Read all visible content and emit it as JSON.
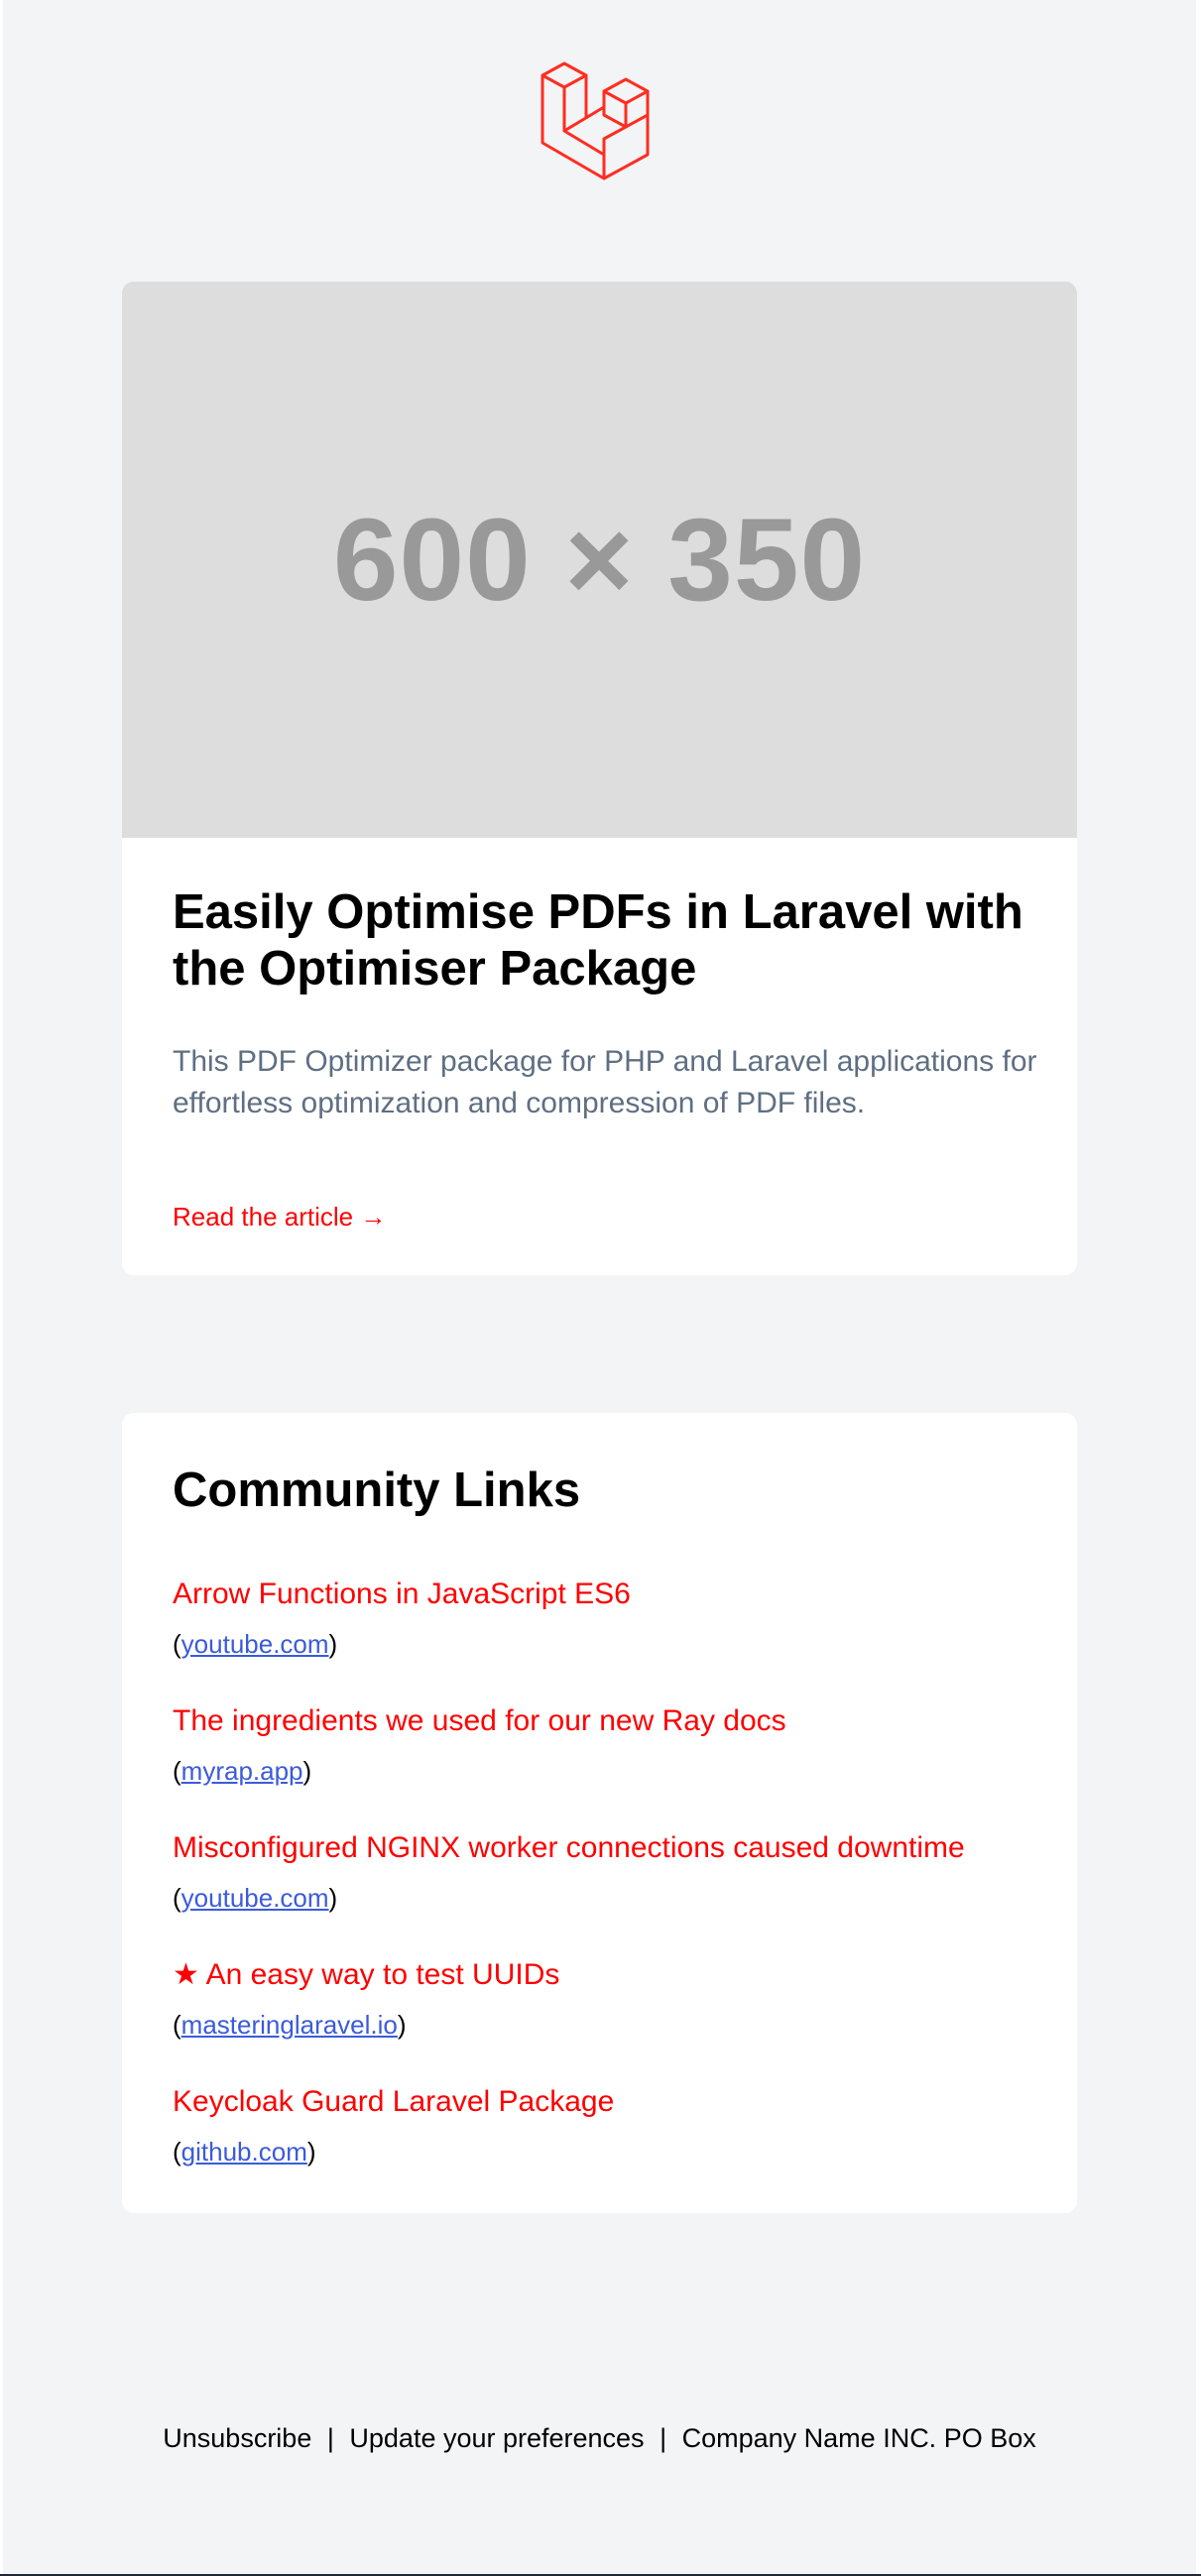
{
  "logo": {
    "icon": "laravel-logo-icon",
    "color": "#ff2d20"
  },
  "article": {
    "image_placeholder": "600 × 350",
    "title": "Easily Optimise PDFs in Laravel with the Optimiser Package",
    "description": "This PDF Optimizer package for PHP and Laravel applications for effortless optimization and compression of PDF files.",
    "read_link": "Read the article →"
  },
  "community": {
    "title": "Community Links",
    "links": [
      {
        "title": "Arrow Functions in JavaScript ES6",
        "source": "youtube.com"
      },
      {
        "title": "The ingredients we used for our new Ray docs",
        "source": "myrap.app"
      },
      {
        "title": "Misconfigured NGINX worker connections caused downtime",
        "source": "youtube.com"
      },
      {
        "title": "★ An easy way to test UUIDs",
        "source": "masteringlaravel.io"
      },
      {
        "title": "Keycloak Guard Laravel Package",
        "source": "github.com"
      }
    ]
  },
  "footer": {
    "unsubscribe": "Unsubscribe",
    "separator": "|",
    "preferences": "Update your preferences",
    "company": "Company Name INC. PO Box"
  },
  "colors": {
    "accent": "#ff0000",
    "link": "#3b5bdb",
    "background": "#f3f4f6",
    "muted": "#5f6f82"
  }
}
